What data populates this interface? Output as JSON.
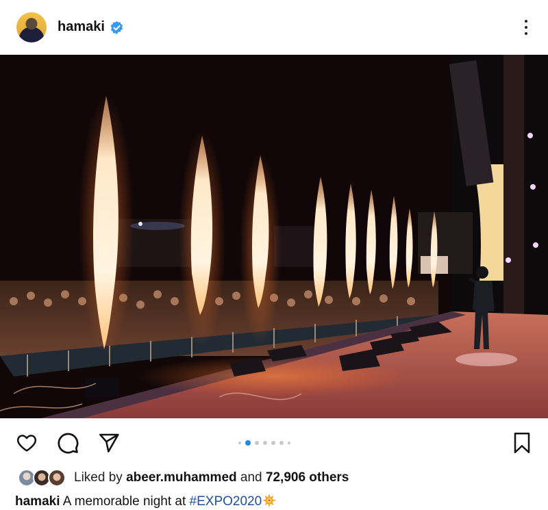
{
  "post": {
    "username": "hamaki",
    "verified": true,
    "icons": {
      "verified": "verified-badge-icon",
      "more": "more-vertical-icon",
      "like": "heart-icon",
      "comment": "comment-icon",
      "share": "send-icon",
      "save": "bookmark-icon"
    },
    "carousel": {
      "total_dots": 7,
      "active_index": 1
    },
    "likes": {
      "prefix": "Liked by",
      "liker": "abeer.muhammed",
      "middle": "and",
      "count_text": "72,906 others"
    },
    "caption": {
      "username": "hamaki",
      "text": "A memorable night at",
      "hashtag": "#EXPO2020",
      "emoji_icon": "sparkle-burst-icon"
    }
  },
  "colors": {
    "verified_blue": "#3897f0",
    "active_dot": "#1e88e5",
    "hashtag": "#1f4f9a"
  }
}
